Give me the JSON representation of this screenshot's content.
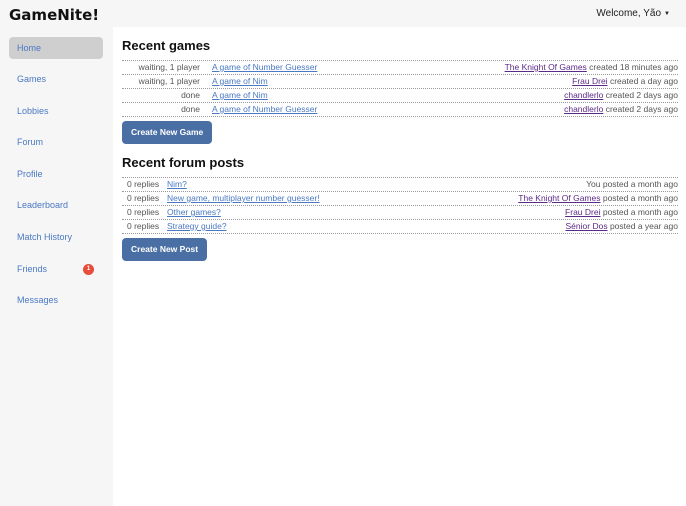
{
  "app": {
    "title": "GameNite!"
  },
  "header": {
    "welcome": "Welcome, Yão"
  },
  "sidebar": {
    "items": [
      {
        "label": "Home"
      },
      {
        "label": "Games"
      },
      {
        "label": "Lobbies"
      },
      {
        "label": "Forum"
      },
      {
        "label": "Profile"
      },
      {
        "label": "Leaderboard"
      },
      {
        "label": "Match History"
      },
      {
        "label": "Friends",
        "badge": "1"
      },
      {
        "label": "Messages"
      }
    ]
  },
  "recent_games": {
    "heading": "Recent games",
    "rows": [
      {
        "status": "waiting, 1 player",
        "title": "A game of Number Guesser",
        "user": "The Knight Of Games",
        "meta": " created 18 minutes ago"
      },
      {
        "status": "waiting, 1 player",
        "title": "A game of Nim",
        "user": "Frau Drei",
        "meta": " created a day ago"
      },
      {
        "status": "done",
        "title": "A game of Nim",
        "user": "chandlerlo",
        "meta": " created 2 days ago"
      },
      {
        "status": "done",
        "title": "A game of Number Guesser",
        "user": "chandlerlo",
        "meta": " created 2 days ago"
      }
    ],
    "button": "Create New Game"
  },
  "recent_posts": {
    "heading": "Recent forum posts",
    "rows": [
      {
        "replies": "0 replies",
        "title": "Nim?",
        "user": "",
        "meta": "You posted a month ago"
      },
      {
        "replies": "0 replies",
        "title": "New game, multiplayer number guesser!",
        "user": "The Knight Of Games",
        "meta": " posted a month ago"
      },
      {
        "replies": "0 replies",
        "title": "Other games?",
        "user": "Frau Drei",
        "meta": " posted a month ago"
      },
      {
        "replies": "0 replies",
        "title": "Strategy guide?",
        "user": "Sénior Dos",
        "meta": " posted a year ago"
      }
    ],
    "button": "Create New Post"
  },
  "colors": {
    "link": "#4a78c2",
    "user_link": "#5b2a86",
    "button": "#4a6fa5",
    "badge": "#e74c3c"
  }
}
